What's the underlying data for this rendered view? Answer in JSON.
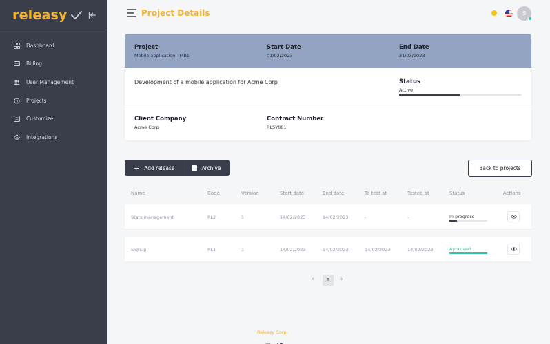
{
  "app": {
    "brand": "releasy"
  },
  "sidebar": {
    "items": [
      {
        "label": "Dashboard",
        "icon": "dashboard-icon"
      },
      {
        "label": "Billing",
        "icon": "billing-icon"
      },
      {
        "label": "User Management",
        "icon": "users-icon"
      },
      {
        "label": "Projects",
        "icon": "projects-icon"
      },
      {
        "label": "Customize",
        "icon": "customize-icon"
      },
      {
        "label": "Integrations",
        "icon": "integrations-icon"
      }
    ]
  },
  "header": {
    "title": "Project Details",
    "avatar_initial": "S"
  },
  "project": {
    "project_label": "Project",
    "project_value": "Mobile application - MB1",
    "start_label": "Start Date",
    "start_value": "01/02/2023",
    "end_label": "End Date",
    "end_value": "31/03/2023",
    "description": "Development of a mobile application for Acme Corp",
    "status_label": "Status",
    "status_value": "Active",
    "status_progress": 0.5,
    "client_label": "Client Company",
    "client_value": "Acme Corp",
    "contract_label": "Contract Number",
    "contract_value": "RLSY001"
  },
  "actions": {
    "add_release": "Add release",
    "archive": "Archive",
    "back": "Back to projects"
  },
  "table": {
    "columns": [
      "Name",
      "Code",
      "Version",
      "Start date",
      "End date",
      "To test at",
      "Tested at",
      "Status",
      "Actions"
    ],
    "rows": [
      {
        "name": "Stats management",
        "code": "RL2",
        "version": "1",
        "start": "14/02/2023",
        "end": "14/02/2023",
        "to_test": "-",
        "tested": "-",
        "status": "In progress",
        "status_progress": 0.2,
        "status_color": "#3a3d4a"
      },
      {
        "name": "Signup",
        "code": "RL1",
        "version": "1",
        "start": "14/02/2023",
        "end": "14/02/2023",
        "to_test": "14/02/2023",
        "tested": "14/02/2023",
        "status": "Approved",
        "status_progress": 1.0,
        "status_color": "#2cc9a8"
      }
    ]
  },
  "pagination": {
    "prev": "‹",
    "current": "1",
    "next": "›"
  },
  "footer": {
    "text": "Releasy Corp."
  },
  "colors": {
    "accent": "#f2b233",
    "sidebar": "#3a3d4a",
    "card_header": "#93a4c2",
    "approved": "#2cc9a8"
  }
}
